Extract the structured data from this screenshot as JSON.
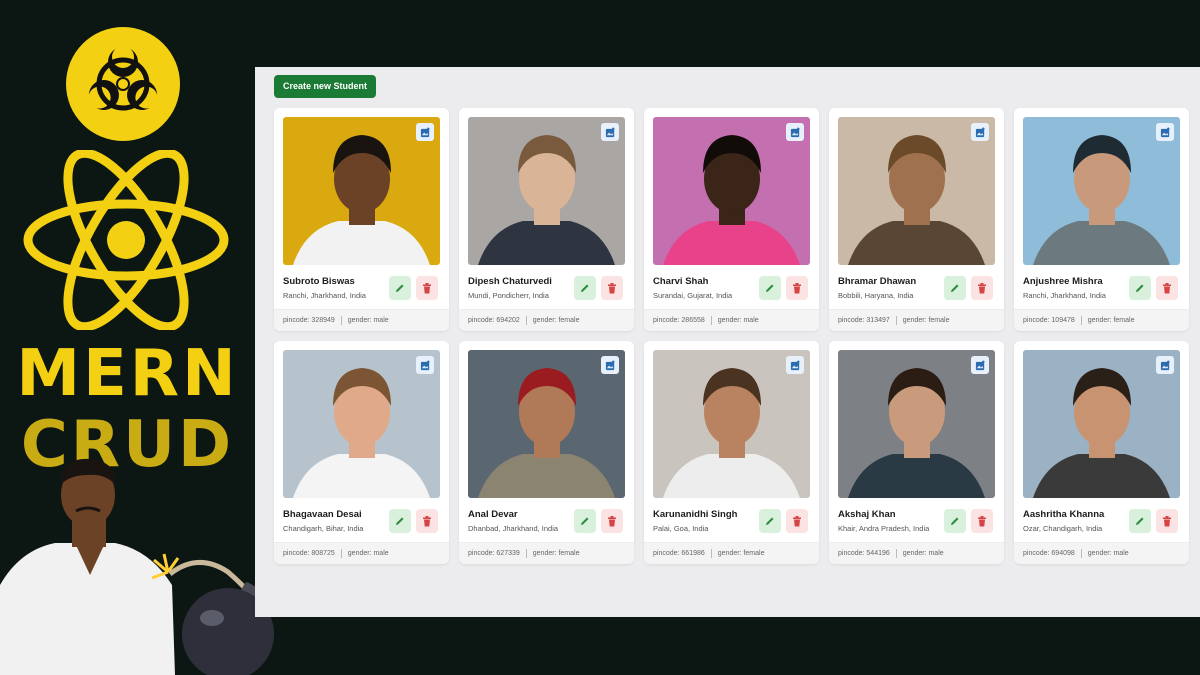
{
  "app": {
    "create_button_label": "Create new Student"
  },
  "branding": {
    "line1": "MERN",
    "line2": "CRUD"
  },
  "colors": {
    "accent_yellow": "#f3d012",
    "primary_green": "#1b7a34",
    "edit_bg": "#d8f0dc",
    "delete_bg": "#fbe3e3"
  },
  "students": [
    {
      "name": "Subroto Biswas",
      "location": "Ranchi, Jharkhand, India",
      "pincode": "pincode: 328949",
      "gender": "gender: male",
      "photo_bg": "#d9a90f",
      "shirt": "#f2f2f2",
      "skin": "#6b4226",
      "hair": "#1a1410"
    },
    {
      "name": "Dipesh Chaturvedi",
      "location": "Mundi, Pondicherr, India",
      "pincode": "pincode: 694202",
      "gender": "gender: female",
      "photo_bg": "#a9a6a3",
      "shirt": "#2e3440",
      "skin": "#d9b497",
      "hair": "#7a5a3c"
    },
    {
      "name": "Charvi Shah",
      "location": "Surandai, Gujarat, India",
      "pincode": "pincode: 286558",
      "gender": "gender: male",
      "photo_bg": "#c46fb0",
      "shirt": "#e8438a",
      "skin": "#3b2418",
      "hair": "#120c08"
    },
    {
      "name": "Bhramar Dhawan",
      "location": "Bobbili, Haryana, India",
      "pincode": "pincode: 313497",
      "gender": "gender: female",
      "photo_bg": "#c9b9a6",
      "shirt": "#5a4635",
      "skin": "#a0714e",
      "hair": "#6b4a2a"
    },
    {
      "name": "Anjushree Mishra",
      "location": "Ranchi, Jharkhand, India",
      "pincode": "pincode: 109478",
      "gender": "gender: female",
      "photo_bg": "#8fbcd9",
      "shirt": "#6c7a80",
      "skin": "#c89a7b",
      "hair": "#1f2b33"
    },
    {
      "name": "Bhagavaan Desai",
      "location": "Chandigarh, Bihar, India",
      "pincode": "pincode: 808725",
      "gender": "gender: male",
      "photo_bg": "#b7c3cc",
      "shirt": "#f4f4f4",
      "skin": "#e0a98a",
      "hair": "#7b5534"
    },
    {
      "name": "Anal Devar",
      "location": "Dhanbad, Jharkhand, India",
      "pincode": "pincode: 627339",
      "gender": "gender: female",
      "photo_bg": "#5a6670",
      "shirt": "#8a8470",
      "skin": "#b07a58",
      "hair": "#9b1c20"
    },
    {
      "name": "Karunanidhi Singh",
      "location": "Palai, Goa, India",
      "pincode": "pincode: 661986",
      "gender": "gender: female",
      "photo_bg": "#c9c4bd",
      "shirt": "#ededed",
      "skin": "#b98361",
      "hair": "#4a3320"
    },
    {
      "name": "Akshaj Khan",
      "location": "Khair, Andra Pradesh, India",
      "pincode": "pincode: 544196",
      "gender": "gender: male",
      "photo_bg": "#7d8084",
      "shirt": "#2a3a45",
      "skin": "#c99a7c",
      "hair": "#2b1d14"
    },
    {
      "name": "Aashritha Khanna",
      "location": "Ozar, Chandigarh, India",
      "pincode": "pincode: 694098",
      "gender": "gender: male",
      "photo_bg": "#9bb1c4",
      "shirt": "#3a3a3a",
      "skin": "#c89370",
      "hair": "#2a2018"
    }
  ]
}
